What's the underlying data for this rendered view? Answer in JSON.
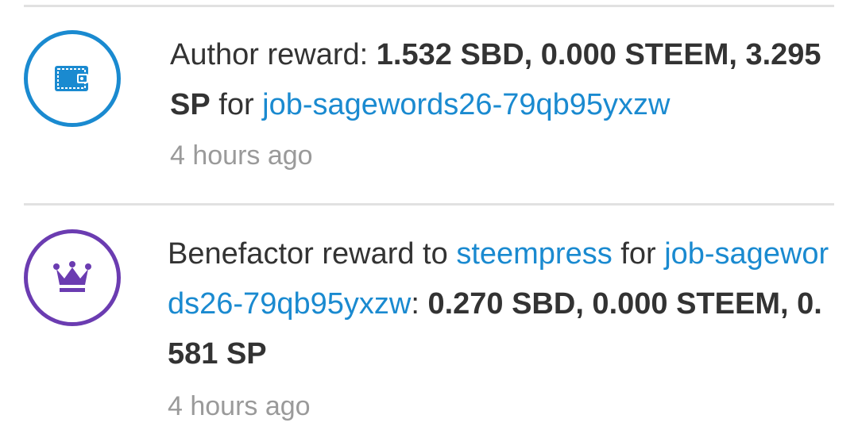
{
  "feed": {
    "author_reward": {
      "label": "Author reward: ",
      "amounts": "1.532 SBD, 0.000 STEEM, 3.295 SP",
      "for_word": " for ",
      "post_link": "job-sagewords26-79qb95yxzw",
      "time": "4 hours ago",
      "icon": "wallet-icon",
      "accent": "#1a8ad0"
    },
    "benefactor_reward": {
      "label": "Benefactor reward to ",
      "beneficiary_link": "steempress",
      "for_word": " for ",
      "post_link": "job-sagewords26-79qb95yxzw",
      "colon": ": ",
      "amounts": "0.270 SBD, 0.000 STEEM, 0.581 SP",
      "time": "4 hours ago",
      "icon": "crown-icon",
      "accent": "#6b3cb1"
    }
  },
  "colors": {
    "link": "#1a8ad0",
    "text": "#333333",
    "muted": "#9a9a9a",
    "divider": "#e1e1e1"
  }
}
